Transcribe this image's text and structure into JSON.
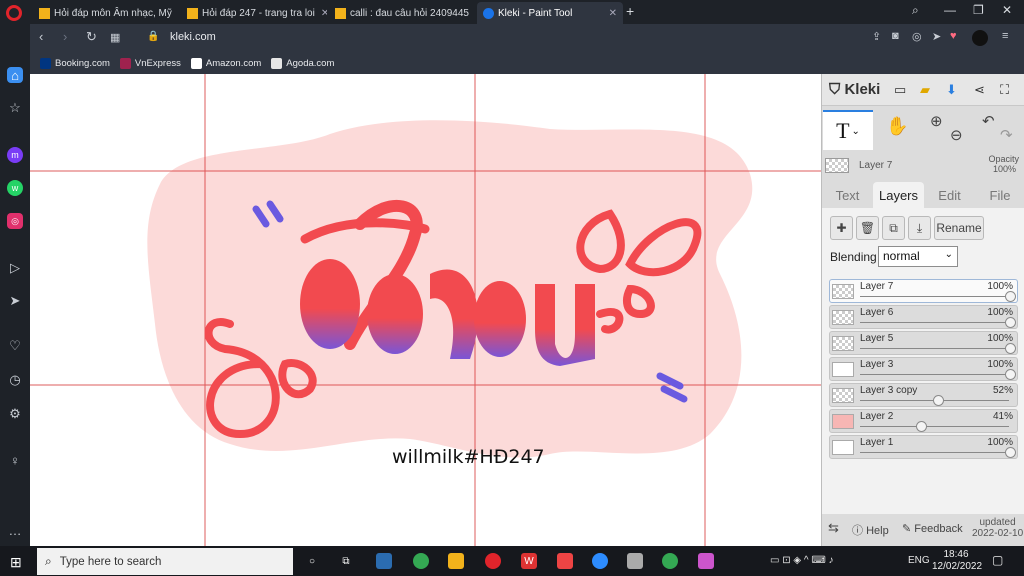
{
  "browser": {
    "tabs": [
      {
        "title": "Hỏi đáp môn Âm nhạc, Mỹ",
        "icon": "h-icon"
      },
      {
        "title": "Hỏi đáp 247 - trang tra loi",
        "icon": "h-icon"
      },
      {
        "title": "calli : đau câu hỏi 2409445",
        "icon": "h-icon"
      },
      {
        "title": "Kleki - Paint Tool",
        "icon": "kleki-icon"
      }
    ],
    "url": "kleki.com",
    "bookmarks": [
      {
        "label": "Booking.com",
        "color": "#003580"
      },
      {
        "label": "VnExpress",
        "color": "#9f224e"
      },
      {
        "label": "Amazon.com",
        "color": "#ffffff"
      },
      {
        "label": "Agoda.com",
        "color": "#e6e6e6"
      }
    ]
  },
  "canvas": {
    "caption": "willmilk#HĐ247",
    "colors": {
      "blob": "#fcdad9",
      "red": "#f24a4f",
      "purple": "#6a5ae0",
      "guide": "#d94040"
    }
  },
  "panel": {
    "app_name": "Kleki",
    "tool_label": "T",
    "current_layer": "Layer 7",
    "opacity_label": "Opacity",
    "opacity_value": "100%",
    "tabs": [
      "Text",
      "Layers",
      "Edit",
      "File"
    ],
    "active_tab": "Layers",
    "rename_label": "Rename",
    "blending_label": "Blending",
    "blending_value": "normal",
    "layers": [
      {
        "name": "Layer 7",
        "opacity": "100%",
        "level": 1.0,
        "selected": true
      },
      {
        "name": "Layer 6",
        "opacity": "100%",
        "level": 1.0
      },
      {
        "name": "Layer 5",
        "opacity": "100%",
        "level": 1.0
      },
      {
        "name": "Layer 3",
        "opacity": "100%",
        "level": 1.0
      },
      {
        "name": "Layer 3 copy",
        "opacity": "52%",
        "level": 0.52
      },
      {
        "name": "Layer 2",
        "opacity": "41%",
        "level": 0.41
      },
      {
        "name": "Layer 1",
        "opacity": "100%",
        "level": 1.0
      }
    ],
    "help_label": "Help",
    "feedback_label": "Feedback",
    "updated_label": "updated",
    "updated_date": "2022-02-10"
  },
  "taskbar": {
    "search_placeholder": "Type here to search",
    "lang": "ENG",
    "time": "18:46",
    "date": "12/02/2022"
  }
}
